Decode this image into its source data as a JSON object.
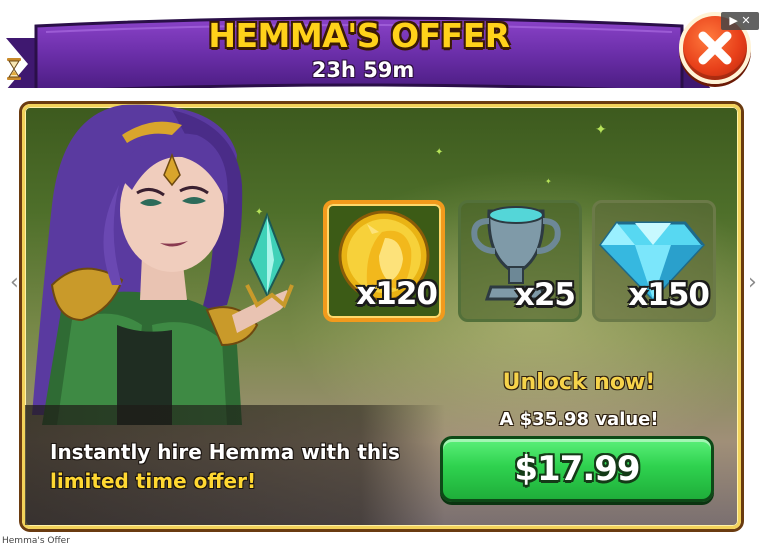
{
  "header": {
    "title": "HEMMA'S OFFER",
    "timer": "23h 59m"
  },
  "ad_badge": "▶ ✕",
  "offer": {
    "items": [
      {
        "name": "hero-tokens",
        "icon": "hemma-token-icon",
        "quantity": "x120"
      },
      {
        "name": "trophies",
        "icon": "trophy-icon",
        "quantity": "x25"
      },
      {
        "name": "gems",
        "icon": "gem-icon",
        "quantity": "x150"
      }
    ],
    "unlock_label": "Unlock now!",
    "value_label": "A $35.98 value!",
    "description_line1": "Instantly hire Hemma with this",
    "description_line2": "limited time offer!",
    "price": "$17.99"
  },
  "caption": "Hemma's Offer",
  "colors": {
    "banner": "#6a2ea8",
    "title": "#ffd21a",
    "buy_button": "#2fd24f",
    "highlight": "#ffd832",
    "close_button": "#e8401a"
  }
}
